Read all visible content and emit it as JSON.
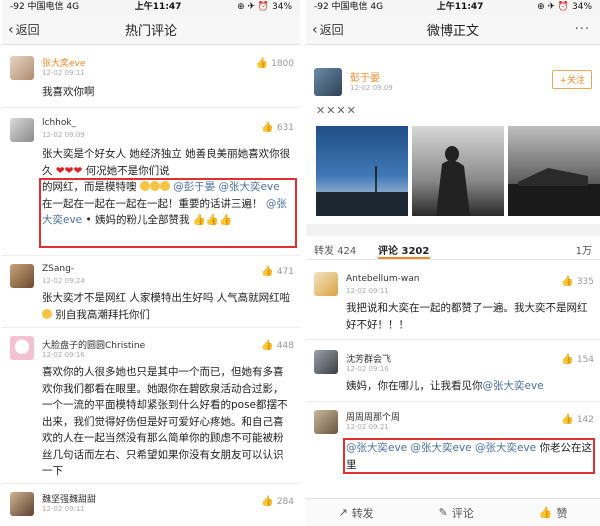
{
  "left": {
    "status": {
      "left": "-92 中国电信  4G",
      "time": "上午11:47",
      "right": "⊕ ✈ ⏰ 34%"
    },
    "nav": {
      "back": "返回",
      "title": "热门评论"
    },
    "comments": [
      {
        "name": "张大奕eve",
        "time": "12-02 09:11",
        "likes": "1800",
        "text": "我喜欢你啊"
      },
      {
        "name": "lchhok_",
        "time": "12-02 09:09",
        "likes": "631",
        "text_a": "张大奕是个好女人 她经济独立 她善良美丽她喜欢你很久",
        "text_b": "何况她不是你们说",
        "text_c": "的网红，而是模特噢",
        "mention1": "@彭于晏",
        "mention2": "@张大奕eve",
        "text_d": "在一起在一起在一起在一起！重要的话讲三遍！",
        "mention3": "@张大奕eve",
        "text_e": "• 姨妈的粉儿全部赞我"
      },
      {
        "name": "ZSang-",
        "time": "12-02 09:24",
        "likes": "471",
        "text_a": "张大奕才不是网红 人家模特出生好吗 人气高就网红啦",
        "text_b": "别自我高潮拜托你们"
      },
      {
        "name": "大脸盘子的圆圆Christine",
        "time": "12-02 09:16",
        "likes": "448",
        "text": "喜欢你的人很多她也只是其中一个而已，但她有多喜欢你我们都看在眼里。她跟你在碧欧泉活动合过影，一个一流的平面模特却紧张到什么好看的pose都摆不出来，我们觉得好伤但是好可爱好心疼她。和自己喜欢的人在一起当然没有那么简单你的顾虑不可能被粉丝几句话而左右、只希望如果你没有女朋友可以认识一下"
      },
      {
        "name": "魏坚强魏甜甜",
        "time": "12-02 09:11",
        "likes": "284"
      }
    ]
  },
  "right": {
    "status": {
      "left": "-92 中国电信  4G",
      "time": "上午11:47",
      "right": "⊕ ✈ ⏰ 34%"
    },
    "nav": {
      "back": "返回",
      "title": "微博正文",
      "more": "···"
    },
    "post": {
      "name": "彭于晏",
      "time": "12-02 09:09",
      "follow": "+关注",
      "text": "✕✕✕✕"
    },
    "tabs": {
      "repost": "转发 424",
      "comments": "评论 3202",
      "likes": "1万"
    },
    "comments": [
      {
        "name": "Antebellum-wan",
        "time": "12-02 09:11",
        "likes": "335",
        "text": "我把说和大奕在一起的都赞了一遍。我大奕不是网红好不好！！！"
      },
      {
        "name": "沈芳群会飞",
        "time": "12-02 09:16",
        "likes": "154",
        "text_a": "姨妈，你在哪儿，让我看见你",
        "mention": "@张大奕eve"
      },
      {
        "name": "周周周那个周",
        "time": "12-02 09:21",
        "likes": "142",
        "m1": "@张大奕eve",
        "m2": "@张大奕eve",
        "m3": "@张大奕eve",
        "text_b": "你老公在这里"
      }
    ],
    "bottom": {
      "repost": "转发",
      "comment": "评论",
      "like": "赞"
    }
  },
  "colors": {
    "accent_red": "#e03030",
    "mention": "#4a6f9f",
    "follow": "#f08a24",
    "vip_name": "#f08a24"
  }
}
